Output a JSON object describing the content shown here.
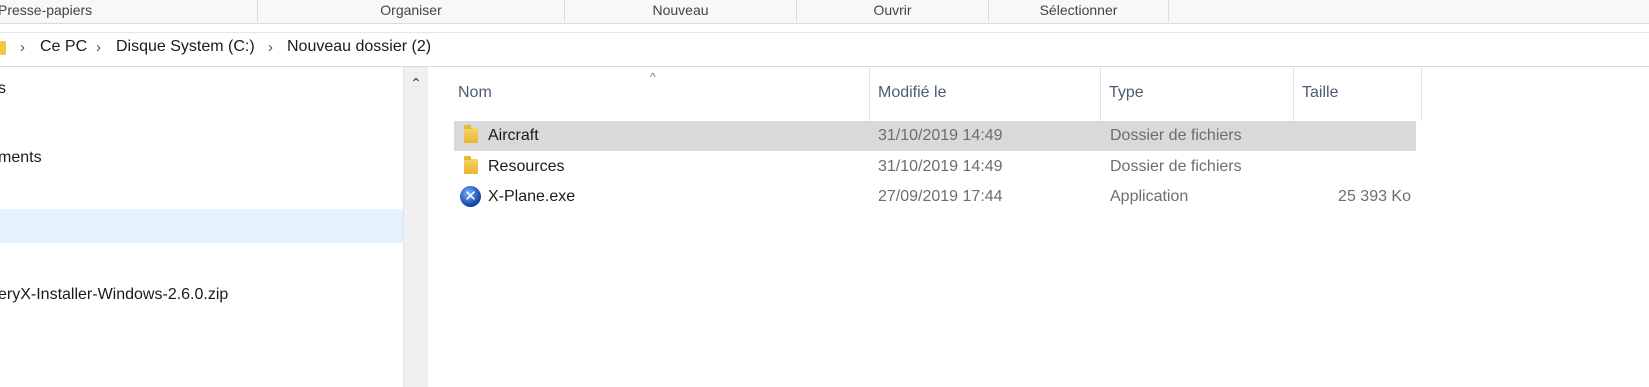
{
  "ribbon": {
    "groups": [
      "Presse-papiers",
      "Organiser",
      "Nouveau",
      "Ouvrir",
      "Sélectionner"
    ]
  },
  "address": {
    "crumbs": [
      "Ce PC",
      "Disque System (C:)",
      "Nouveau dossier (2)"
    ],
    "separator": "›"
  },
  "nav": {
    "items": [
      "s",
      "ments",
      "eryX-Installer-Windows-2.6.0.zip"
    ],
    "scroll_up_glyph": "⌃"
  },
  "filelist": {
    "sort_indicator": "^",
    "columns": [
      "Nom",
      "Modifié le",
      "Type",
      "Taille"
    ],
    "rows": [
      {
        "name": "Aircraft",
        "modified": "31/10/2019 14:49",
        "type": "Dossier de fichiers",
        "size": "",
        "icon": "folder-icon",
        "selected": true
      },
      {
        "name": "Resources",
        "modified": "31/10/2019 14:49",
        "type": "Dossier de fichiers",
        "size": "",
        "icon": "folder-icon",
        "selected": false
      },
      {
        "name": "X-Plane.exe",
        "modified": "27/09/2019 17:44",
        "type": "Application",
        "size": "25 393 Ko",
        "icon": "x-plane-app-icon",
        "selected": false
      }
    ]
  },
  "colors": {
    "selection": "#d9d9d9",
    "nav_selection": "#e5f1fb",
    "header_text": "#4d5b70",
    "folder": "#e8b630"
  }
}
